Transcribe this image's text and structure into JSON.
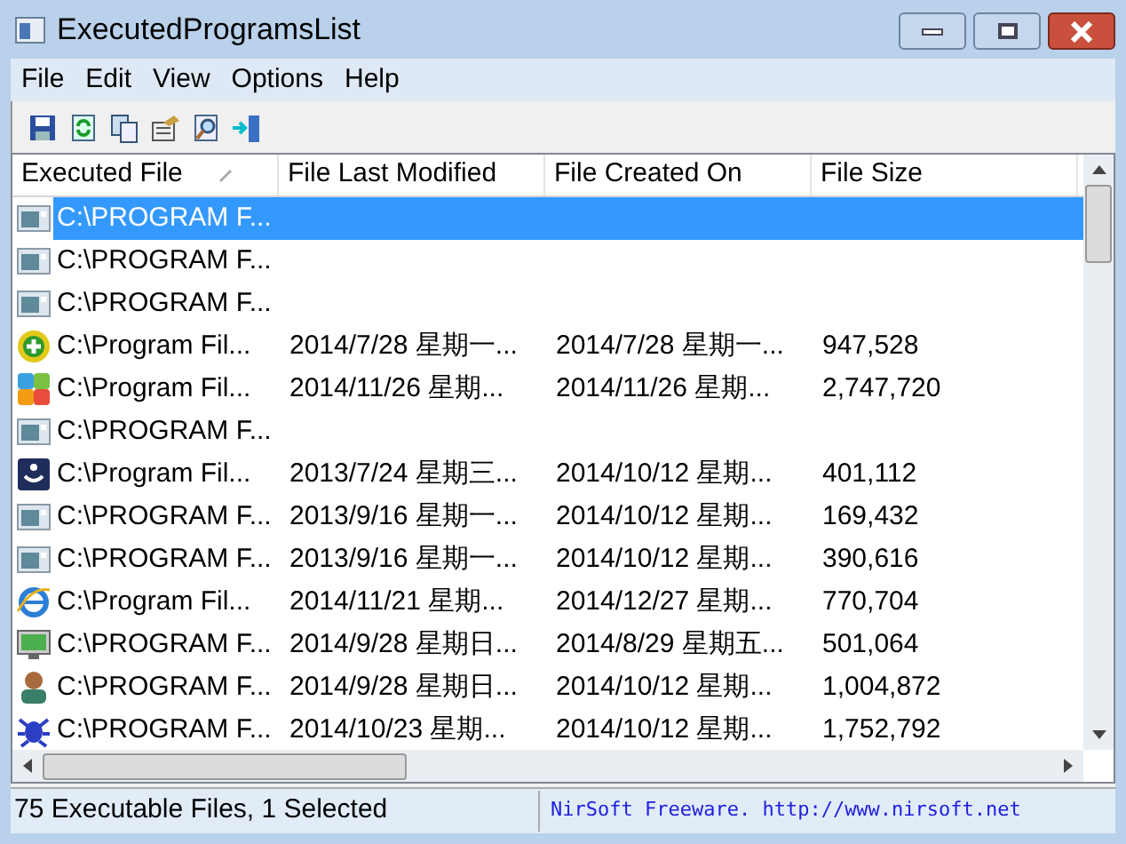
{
  "window": {
    "title": "ExecutedProgramsList"
  },
  "menu": [
    "File",
    "Edit",
    "View",
    "Options",
    "Help"
  ],
  "toolbar": [
    {
      "kind": "save"
    },
    {
      "kind": "refresh"
    },
    {
      "kind": "copy"
    },
    {
      "kind": "properties"
    },
    {
      "kind": "find"
    },
    {
      "kind": "exit"
    }
  ],
  "table": {
    "columns": [
      {
        "label": "Executed File",
        "sorted": true
      },
      {
        "label": "File Last Modified",
        "sorted": false
      },
      {
        "label": "File Created On",
        "sorted": false
      },
      {
        "label": "File Size",
        "sorted": false
      }
    ],
    "rows": [
      {
        "kind": "window",
        "selected": true,
        "cells": [
          "C:\\PROGRAM F...",
          "",
          "",
          ""
        ]
      },
      {
        "kind": "window",
        "selected": false,
        "cells": [
          "C:\\PROGRAM F...",
          "",
          "",
          ""
        ]
      },
      {
        "kind": "window",
        "selected": false,
        "cells": [
          "C:\\PROGRAM F...",
          "",
          "",
          ""
        ]
      },
      {
        "kind": "plus",
        "selected": false,
        "cells": [
          "C:\\Program Fil...",
          "2014/7/28 星期一...",
          "2014/7/28 星期一...",
          "947,528"
        ]
      },
      {
        "kind": "tiles",
        "selected": false,
        "cells": [
          "C:\\Program Fil...",
          "2014/11/26 星期...",
          "2014/11/26 星期...",
          "2,747,720"
        ]
      },
      {
        "kind": "window",
        "selected": false,
        "cells": [
          "C:\\PROGRAM F...",
          "",
          "",
          ""
        ]
      },
      {
        "kind": "dark",
        "selected": false,
        "cells": [
          "C:\\Program Fil...",
          "2013/7/24 星期三...",
          "2014/10/12 星期...",
          "401,112"
        ]
      },
      {
        "kind": "window",
        "selected": false,
        "cells": [
          "C:\\PROGRAM F...",
          "2013/9/16 星期一...",
          "2014/10/12 星期...",
          "169,432"
        ]
      },
      {
        "kind": "window",
        "selected": false,
        "cells": [
          "C:\\PROGRAM F...",
          "2013/9/16 星期一...",
          "2014/10/12 星期...",
          "390,616"
        ]
      },
      {
        "kind": "browser",
        "selected": false,
        "cells": [
          "C:\\Program Fil...",
          "2014/11/21 星期...",
          "2014/12/27 星期...",
          "770,704"
        ]
      },
      {
        "kind": "monitor",
        "selected": false,
        "cells": [
          "C:\\PROGRAM F...",
          "2014/9/28 星期日...",
          "2014/8/29 星期五...",
          "501,064"
        ]
      },
      {
        "kind": "person",
        "selected": false,
        "cells": [
          "C:\\PROGRAM F...",
          "2014/9/28 星期日...",
          "2014/10/12 星期...",
          "1,004,872"
        ]
      },
      {
        "kind": "bug",
        "selected": false,
        "cells": [
          "C:\\PROGRAM F...",
          "2014/10/23 星期...",
          "2014/10/12 星期...",
          "1,752,792"
        ]
      }
    ]
  },
  "status_bar": [
    "75 Executable Files, 1 Selected",
    "NirSoft Freeware.  http://www.nirsoft.net"
  ]
}
